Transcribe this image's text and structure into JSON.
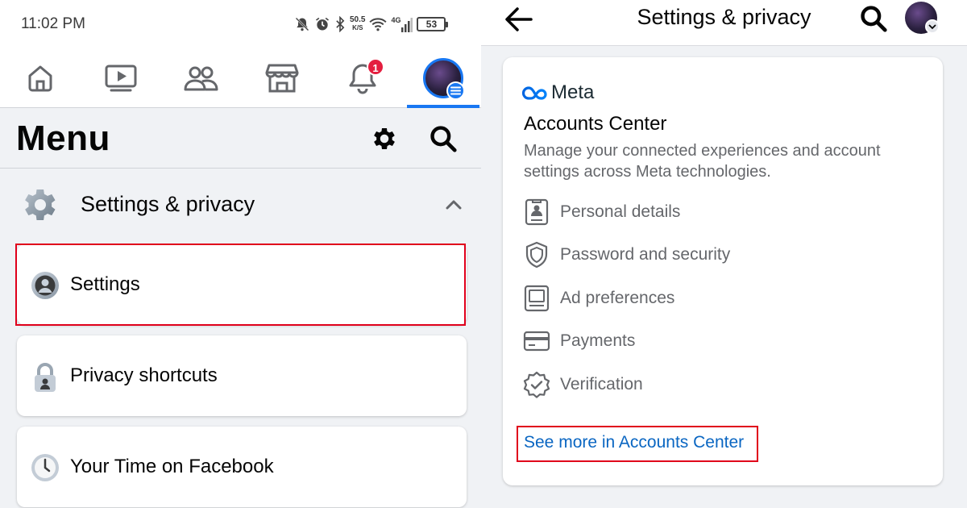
{
  "status_bar": {
    "time": "11:02 PM",
    "net_speed_value": "50.5",
    "net_speed_unit": "K/S",
    "network_type": "4G",
    "battery_level": "53"
  },
  "nav": {
    "tabs": [
      "home",
      "watch",
      "friends",
      "marketplace",
      "notifications",
      "menu"
    ],
    "notification_count": "1",
    "active_tab": "menu"
  },
  "menu": {
    "title": "Menu",
    "section_label": "Settings & privacy",
    "items": [
      {
        "label": "Settings",
        "icon": "person-circle-icon"
      },
      {
        "label": "Privacy shortcuts",
        "icon": "lock-icon"
      },
      {
        "label": "Your Time on Facebook",
        "icon": "clock-icon"
      }
    ]
  },
  "settings_page": {
    "title": "Settings & privacy",
    "accounts_center": {
      "brand": "Meta",
      "title": "Accounts Center",
      "description": "Manage your connected experiences and account settings across Meta technologies.",
      "items": [
        {
          "label": "Personal details",
          "icon": "id-card-icon"
        },
        {
          "label": "Password and security",
          "icon": "shield-icon"
        },
        {
          "label": "Ad preferences",
          "icon": "monitor-icon"
        },
        {
          "label": "Payments",
          "icon": "credit-card-icon"
        },
        {
          "label": "Verification",
          "icon": "verified-badge-icon"
        }
      ],
      "see_more": "See more in Accounts Center"
    }
  },
  "colors": {
    "accent": "#1877f2",
    "highlight_outline": "#e0001b",
    "link": "#0a66c2",
    "badge": "#e41e3f"
  }
}
